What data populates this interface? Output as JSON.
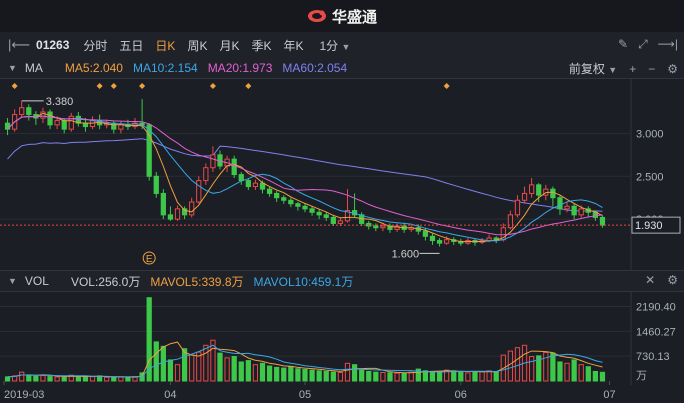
{
  "app": {
    "title": "华盛通"
  },
  "toolbar": {
    "symbol": "01263",
    "periods": [
      "分时",
      "五日",
      "日K",
      "周K",
      "月K",
      "季K",
      "年K"
    ],
    "active_period": "日K",
    "interval": "1分"
  },
  "main_legend": {
    "name": "MA",
    "ma5": "MA5:2.040",
    "ma10": "MA10:2.154",
    "ma20": "MA20:1.973",
    "ma60": "MA60:2.054",
    "adjust": "前复权"
  },
  "vol_legend": {
    "name": "VOL",
    "vol": "VOL:256.0万",
    "mavol5": "MAVOL5:339.8万",
    "mavol10": "MAVOL10:459.1万"
  },
  "colors": {
    "up": "#e84a4a",
    "down": "#3ec84a",
    "ma5": "#f0a040",
    "ma10": "#3aa8e8",
    "ma20": "#e060d0",
    "ma60": "#8080f0"
  },
  "chart_data": [
    {
      "type": "candlestick",
      "x_labels": [
        "2019-03",
        "04",
        "05",
        "06",
        "07"
      ],
      "y_ticks": [
        3.0,
        2.5,
        2.0
      ],
      "y_tick_labels": [
        "3.000",
        "2.500",
        "2.000"
      ],
      "ylim": [
        1.5,
        3.6
      ],
      "current_price": "1.930",
      "annotations": {
        "high": "3.380",
        "low": "1.600",
        "event": "E"
      },
      "candles": [
        [
          3.12,
          3.05,
          3.18,
          2.98
        ],
        [
          3.05,
          3.22,
          3.28,
          3.02
        ],
        [
          3.22,
          3.3,
          3.38,
          3.18
        ],
        [
          3.3,
          3.22,
          3.34,
          3.15
        ],
        [
          3.22,
          3.18,
          3.26,
          3.1
        ],
        [
          3.18,
          3.25,
          3.3,
          3.12
        ],
        [
          3.25,
          3.1,
          3.28,
          3.05
        ],
        [
          3.1,
          3.15,
          3.2,
          3.05
        ],
        [
          3.15,
          3.05,
          3.18,
          3.0
        ],
        [
          3.05,
          3.2,
          3.24,
          3.02
        ],
        [
          3.2,
          3.12,
          3.25,
          3.08
        ],
        [
          3.12,
          3.08,
          3.18,
          3.02
        ],
        [
          3.08,
          3.15,
          3.2,
          3.05
        ],
        [
          3.15,
          3.1,
          3.22,
          3.05
        ],
        [
          3.1,
          3.12,
          3.16,
          3.06
        ],
        [
          3.12,
          3.05,
          3.15,
          3.0
        ],
        [
          3.05,
          3.1,
          3.14,
          3.0
        ],
        [
          3.1,
          3.08,
          3.16,
          3.04
        ],
        [
          3.08,
          3.12,
          3.18,
          3.05
        ],
        [
          3.12,
          3.1,
          3.4,
          3.05
        ],
        [
          3.1,
          2.5,
          3.12,
          2.45
        ],
        [
          2.5,
          2.3,
          2.55,
          2.25
        ],
        [
          2.3,
          2.05,
          2.35,
          2.0
        ],
        [
          2.05,
          2.0,
          2.15,
          1.98
        ],
        [
          2.0,
          2.12,
          2.16,
          1.98
        ],
        [
          2.12,
          2.05,
          2.15,
          2.0
        ],
        [
          2.05,
          2.2,
          2.25,
          2.02
        ],
        [
          2.2,
          2.45,
          2.5,
          2.18
        ],
        [
          2.45,
          2.6,
          2.65,
          2.4
        ],
        [
          2.6,
          2.75,
          2.85,
          2.55
        ],
        [
          2.75,
          2.62,
          2.8,
          2.58
        ],
        [
          2.62,
          2.7,
          2.74,
          2.55
        ],
        [
          2.7,
          2.52,
          2.74,
          2.48
        ],
        [
          2.52,
          2.45,
          2.55,
          2.4
        ],
        [
          2.45,
          2.38,
          2.48,
          2.34
        ],
        [
          2.38,
          2.42,
          2.46,
          2.34
        ],
        [
          2.42,
          2.35,
          2.45,
          2.3
        ],
        [
          2.35,
          2.3,
          2.38,
          2.26
        ],
        [
          2.3,
          2.25,
          2.33,
          2.2
        ],
        [
          2.25,
          2.22,
          2.28,
          2.18
        ],
        [
          2.22,
          2.18,
          2.25,
          2.14
        ],
        [
          2.18,
          2.15,
          2.2,
          2.1
        ],
        [
          2.15,
          2.12,
          2.18,
          2.08
        ],
        [
          2.12,
          2.08,
          2.15,
          2.04
        ],
        [
          2.08,
          2.05,
          2.12,
          2.0
        ],
        [
          2.05,
          2.02,
          2.08,
          1.98
        ],
        [
          2.02,
          1.95,
          2.05,
          1.92
        ],
        [
          1.95,
          1.98,
          2.02,
          1.92
        ],
        [
          1.98,
          2.1,
          2.35,
          1.96
        ],
        [
          2.1,
          2.05,
          2.3,
          2.02
        ],
        [
          2.05,
          1.95,
          2.08,
          1.92
        ],
        [
          1.95,
          1.92,
          1.98,
          1.88
        ],
        [
          1.92,
          1.9,
          1.95,
          1.86
        ],
        [
          1.9,
          1.92,
          1.96,
          1.86
        ],
        [
          1.92,
          1.88,
          1.95,
          1.84
        ],
        [
          1.88,
          1.92,
          1.95,
          1.85
        ],
        [
          1.92,
          1.88,
          1.96,
          1.84
        ],
        [
          1.88,
          1.9,
          1.93,
          1.85
        ],
        [
          1.9,
          1.86,
          1.94,
          1.82
        ],
        [
          1.86,
          1.8,
          1.9,
          1.75
        ],
        [
          1.8,
          1.75,
          1.83,
          1.7
        ],
        [
          1.75,
          1.72,
          1.78,
          1.68
        ],
        [
          1.72,
          1.76,
          1.8,
          1.7
        ],
        [
          1.76,
          1.74,
          1.79,
          1.7
        ],
        [
          1.74,
          1.72,
          1.77,
          1.69
        ],
        [
          1.72,
          1.75,
          1.78,
          1.7
        ],
        [
          1.75,
          1.73,
          1.77,
          1.69
        ],
        [
          1.73,
          1.75,
          1.78,
          1.71
        ],
        [
          1.75,
          1.78,
          1.82,
          1.73
        ],
        [
          1.78,
          1.76,
          1.8,
          1.72
        ],
        [
          1.76,
          1.9,
          1.95,
          1.74
        ],
        [
          1.9,
          2.05,
          2.1,
          1.88
        ],
        [
          2.05,
          2.22,
          2.28,
          2.02
        ],
        [
          2.22,
          2.3,
          2.38,
          2.18
        ],
        [
          2.3,
          2.4,
          2.48,
          2.25
        ],
        [
          2.4,
          2.28,
          2.42,
          2.2
        ],
        [
          2.28,
          2.35,
          2.4,
          2.22
        ],
        [
          2.35,
          2.25,
          2.38,
          2.15
        ],
        [
          2.25,
          2.12,
          2.28,
          2.05
        ],
        [
          2.12,
          2.15,
          2.2,
          2.08
        ],
        [
          2.15,
          2.05,
          2.18,
          2.0
        ],
        [
          2.05,
          2.12,
          2.16,
          2.02
        ],
        [
          2.12,
          2.08,
          2.15,
          2.03
        ],
        [
          2.08,
          2.02,
          2.1,
          1.98
        ],
        [
          2.02,
          1.93,
          2.04,
          1.9
        ]
      ]
    },
    {
      "type": "bar",
      "name": "VOL",
      "y_ticks": [
        2190.4,
        1460.27,
        730.13
      ],
      "y_tick_labels": [
        "2190.40",
        "1460.27",
        "730.13"
      ],
      "unit": "万",
      "ylim": [
        0,
        2500
      ],
      "values": [
        120,
        150,
        260,
        180,
        140,
        160,
        130,
        120,
        110,
        170,
        140,
        120,
        130,
        150,
        110,
        100,
        120,
        110,
        130,
        240,
        2450,
        1150,
        1020,
        620,
        480,
        950,
        760,
        850,
        1050,
        1200,
        820,
        680,
        720,
        560,
        600,
        480,
        520,
        440,
        400,
        380,
        420,
        360,
        340,
        320,
        300,
        280,
        260,
        250,
        520,
        480,
        320,
        280,
        260,
        250,
        240,
        230,
        220,
        260,
        350,
        300,
        280,
        260,
        320,
        300,
        280,
        240,
        260,
        270,
        300,
        280,
        760,
        880,
        980,
        1050,
        720,
        740,
        840,
        820,
        560,
        520,
        620,
        480,
        420,
        280,
        256
      ],
      "mavol5": [],
      "mavol10": []
    }
  ]
}
